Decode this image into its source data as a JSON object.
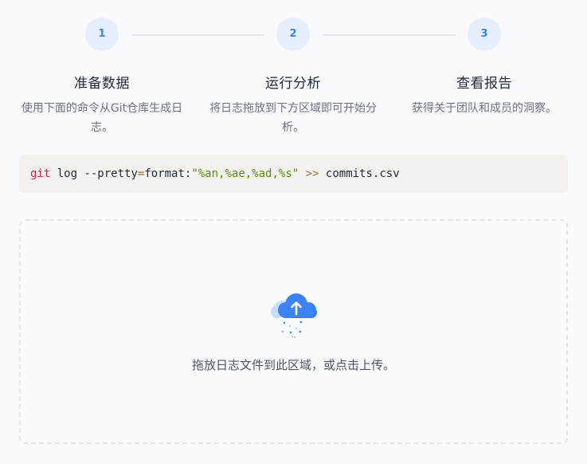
{
  "steps": [
    {
      "number": "1",
      "title": "准备数据",
      "description": "使用下面的命令从Git仓库生成日志。"
    },
    {
      "number": "2",
      "title": "运行分析",
      "description": "将日志拖放到下方区域即可开始分析。"
    },
    {
      "number": "3",
      "title": "查看报告",
      "description": "获得关于团队和成员的洞察。"
    }
  ],
  "command": {
    "cmd": "git",
    "args1": " log --pretty",
    "eq": "=",
    "args2": "format:",
    "format": "\"%an,%ae,%ad,%s\"",
    "sp": " ",
    "redirect": ">>",
    "file": " commits.csv"
  },
  "dropzone": {
    "icon": "cloud-upload-icon",
    "text": "拖放日志文件到此区域，或点击上传。"
  },
  "colors": {
    "accent": "#3b82f6",
    "accent_light": "#e6efff",
    "background": "#f8fafc"
  }
}
